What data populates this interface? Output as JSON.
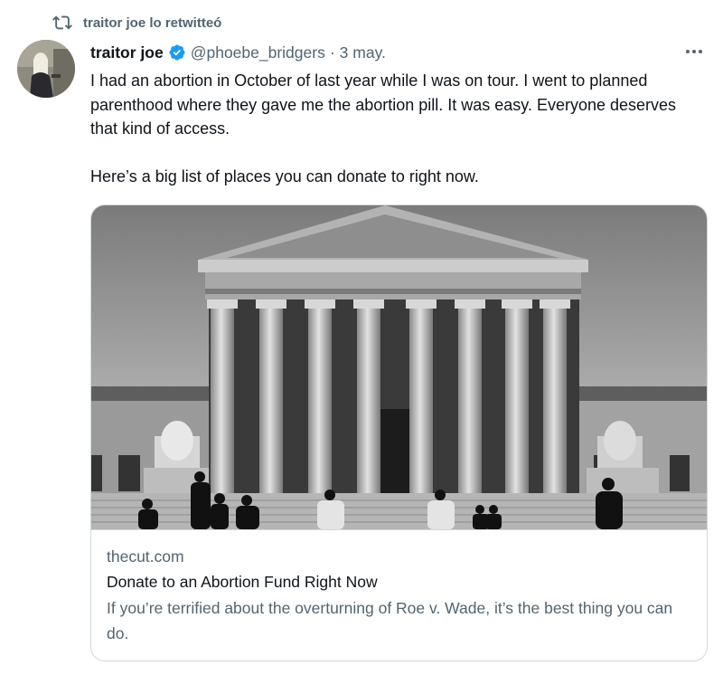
{
  "retweet": {
    "text": "traitor joe lo retwitteó",
    "icon": "retweet-icon"
  },
  "tweet": {
    "author_name": "traitor joe",
    "verified_icon": "verified-badge-icon",
    "handle": "@phoebe_bridgers",
    "separator": "·",
    "date": "3 may.",
    "more_icon": "more-options-icon",
    "paragraphs": [
      "I had an abortion in October of last year while I was on tour. I went to planned parenthood where they gave me the abortion pill. It was easy. Everyone deserves that kind of access.",
      "Here’s a big list of places you can donate to right now."
    ]
  },
  "card": {
    "domain": "thecut.com",
    "title": "Donate to an Abortion Fund Right Now",
    "description": "If you’re terrified about the overturning of Roe v. Wade, it’s the best thing you can do."
  },
  "colors": {
    "text_primary": "#0f1419",
    "text_secondary": "#536471",
    "verified_blue": "#1d9bf0",
    "border": "#cfd9de"
  }
}
